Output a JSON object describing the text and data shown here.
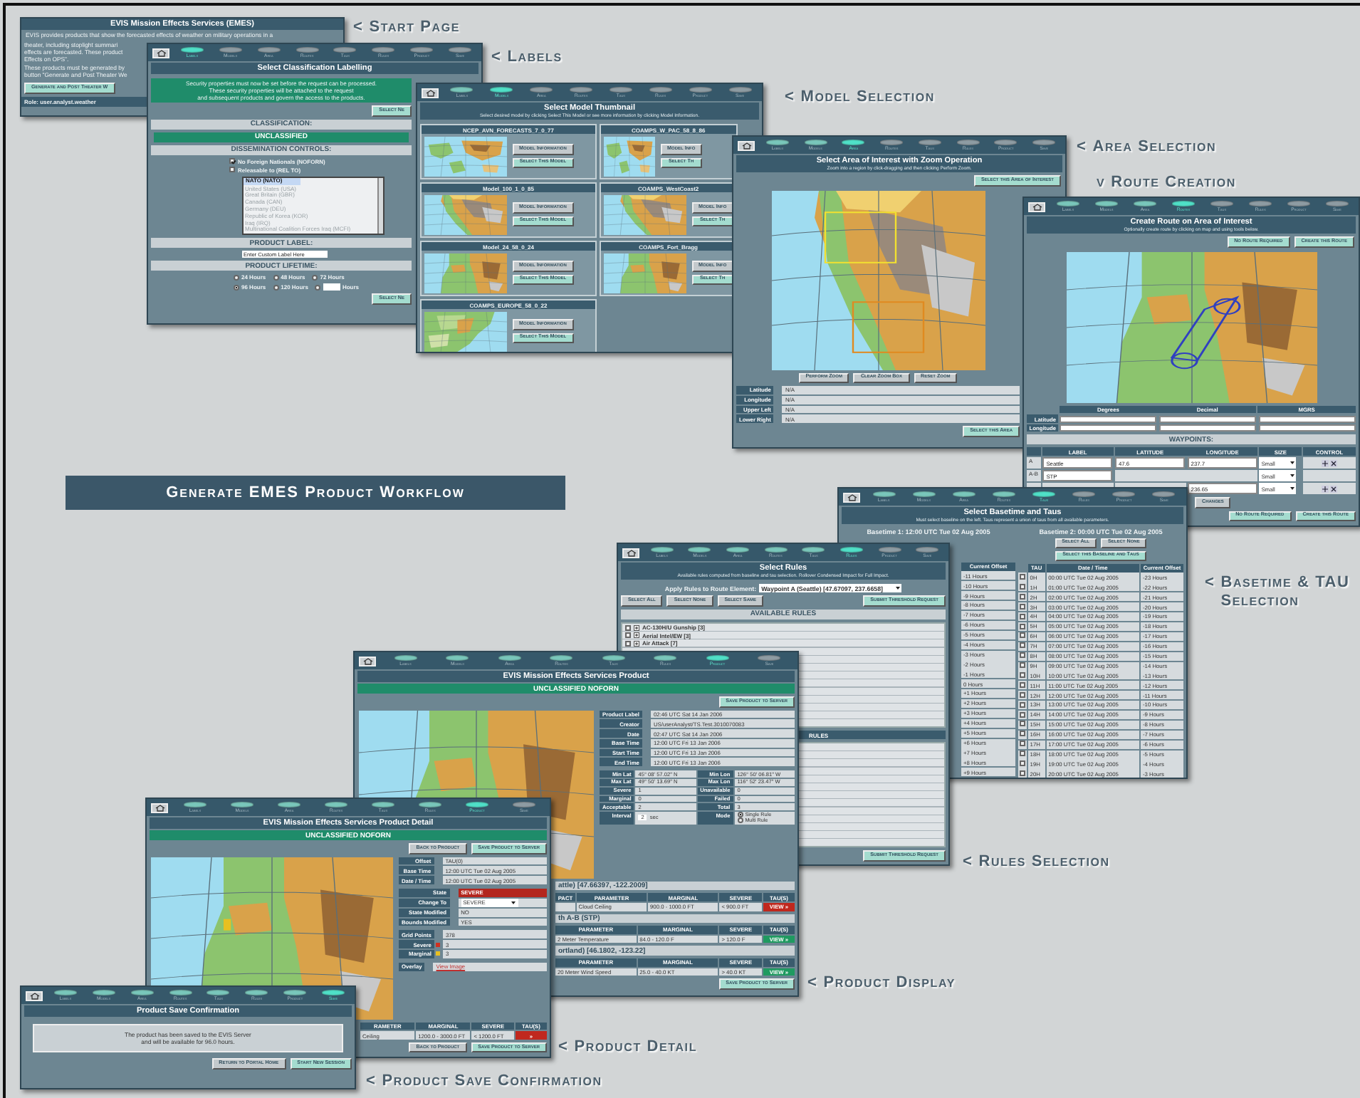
{
  "banner": {
    "title": "Generate EMES Product Workflow"
  },
  "captions": [
    {
      "arrow": "<",
      "lines": [
        "Start Page"
      ]
    },
    {
      "arrow": "<",
      "lines": [
        "Labels"
      ]
    },
    {
      "arrow": "<",
      "lines": [
        "Model Selection"
      ]
    },
    {
      "arrow": "<",
      "lines": [
        "Area Selection"
      ]
    },
    {
      "arrow": "v",
      "lines": [
        "Route Creation"
      ]
    },
    {
      "arrow": "<",
      "lines": [
        "Basetime & TAU",
        "Selection"
      ]
    },
    {
      "arrow": "<",
      "lines": [
        "Rules Selection"
      ]
    },
    {
      "arrow": "<",
      "lines": [
        "Product Display"
      ]
    },
    {
      "arrow": "<",
      "lines": [
        "Product Detail"
      ]
    },
    {
      "arrow": "<",
      "lines": [
        "Product Save Confirmation"
      ]
    }
  ],
  "windows": [
    {
      "title": "EVIS Mission Effects Services (EMES)",
      "lead": "EVIS provides products that show the forecasted effects of weather on military operations in a",
      "blocks": [
        {
          "kind": "text",
          "lines": [
            "theater, including stoplight summari",
            "effects are forecasted. These product",
            "Effects on OPS\"."
          ]
        },
        {
          "kind": "text",
          "lines": [
            "These products must be generated by",
            "button \"Generate and Post Theater We"
          ]
        },
        {
          "kind": "buttons",
          "items": [
            {
              "label": "Generate and Post Theater W",
              "kind": "action"
            }
          ]
        },
        {
          "kind": "footer",
          "text": "Role: user.analyst.weather"
        }
      ]
    },
    {
      "steps": [
        {
          "label": "Labels",
          "selected": true,
          "done": false
        },
        {
          "label": "Models",
          "selected": false,
          "done": false
        },
        {
          "label": "Area",
          "selected": false,
          "done": false
        },
        {
          "label": "Routes",
          "selected": false,
          "done": false
        },
        {
          "label": "Taus",
          "selected": false,
          "done": false
        },
        {
          "label": "Rules",
          "selected": false,
          "done": false
        },
        {
          "label": "Product",
          "selected": false,
          "done": false
        },
        {
          "label": "Save",
          "selected": false,
          "done": false
        }
      ],
      "title": "Select Classification Labelling",
      "blocks": [
        {
          "kind": "notice",
          "lines": [
            "Security properties must now be set before the request can be processed.",
            "These security properties will be attached to the request",
            "and subsequent products and govern the access to the products."
          ]
        },
        {
          "kind": "buttons",
          "items": [
            {
              "label": "Select Ne",
              "kind": "action"
            }
          ]
        },
        {
          "kind": "heading",
          "text": "CLASSIFICATION:"
        },
        {
          "kind": "banner",
          "text": "UNCLASSIFIED"
        },
        {
          "kind": "heading",
          "text": "DISSEMINATION CONTROLS:"
        },
        {
          "kind": "checks",
          "items": [
            {
              "label": "No Foreign Nationals (NOFORN)",
              "checked": true
            },
            {
              "label": "Releasable to (REL TO)",
              "checked": false
            }
          ]
        },
        {
          "kind": "listbox",
          "disabled": true,
          "items": [
            {
              "label": "NATO (NATO)",
              "selected": true
            },
            {
              "label": "United States (USA)",
              "selected": false
            },
            {
              "label": "Great Britain (GBR)",
              "selected": false
            },
            {
              "label": "Canada (CAN)",
              "selected": false
            },
            {
              "label": "Germany (DEU)",
              "selected": false
            },
            {
              "label": "Republic of Korea (KOR)",
              "selected": false
            },
            {
              "label": "Iraq (IRQ)",
              "selected": false
            },
            {
              "label": "Multinational Coalition Forces Iraq (MCFI)",
              "selected": false
            }
          ]
        },
        {
          "kind": "heading",
          "text": "PRODUCT LABEL:"
        },
        {
          "kind": "field",
          "value": "Enter Custom Label Here"
        },
        {
          "kind": "heading",
          "text": "PRODUCT LIFETIME:"
        },
        {
          "kind": "radios",
          "rows": [
            [
              {
                "label": "24 Hours",
                "selected": false
              },
              {
                "label": "48 Hours",
                "selected": false
              },
              {
                "label": "72 Hours",
                "selected": false
              }
            ],
            [
              {
                "label": "96 Hours",
                "selected": true
              },
              {
                "label": "120 Hours",
                "selected": false
              },
              {
                "label": "Hours",
                "selected": false,
                "input": true
              }
            ]
          ]
        },
        {
          "kind": "buttons",
          "items": [
            {
              "label": "Select Ne",
              "kind": "action"
            }
          ]
        }
      ]
    },
    {
      "steps": [
        {
          "label": "Labels",
          "selected": false,
          "done": true
        },
        {
          "label": "Models",
          "selected": true,
          "done": false
        },
        {
          "label": "Area",
          "selected": false,
          "done": false
        },
        {
          "label": "Routes",
          "selected": false,
          "done": false
        },
        {
          "label": "Taus",
          "selected": false,
          "done": false
        },
        {
          "label": "Rules",
          "selected": false,
          "done": false
        },
        {
          "label": "Product",
          "selected": false,
          "done": false
        },
        {
          "label": "Save",
          "selected": false,
          "done": false
        }
      ],
      "title": "Select Model Thumbnail",
      "subtitle": "Select desired model by clicking Select This Model or see more information by clicking Model Information.",
      "blocks": [
        {
          "kind": "models",
          "columns": [
            [
              {
                "name": "NCEP_AVN_FORECASTS_7_0_77",
                "buttons": [
                  "Model Information",
                  "Select This Model"
                ]
              },
              {
                "name": "Model_100_1_0_85",
                "buttons": [
                  "Model Information",
                  "Select This Model"
                ]
              },
              {
                "name": "Model_24_58_0_24",
                "buttons": [
                  "Model Information",
                  "Select This Model"
                ]
              },
              {
                "name": "COAMPS_EUROPE_58_0_22",
                "buttons": [
                  "Model Information",
                  "Select This Model"
                ]
              }
            ],
            [
              {
                "name": "COAMPS_W_PAC_58_8_86",
                "buttons": [
                  "Model Info",
                  "Select Th"
                ]
              },
              {
                "name": "COAMPS_WestCoast2",
                "buttons": [
                  "Model Info",
                  "Select Th"
                ]
              },
              {
                "name": "COAMPS_Fort_Bragg",
                "buttons": [
                  "Model Info",
                  "Select Th"
                ]
              }
            ]
          ]
        }
      ]
    },
    {
      "steps": [
        {
          "label": "Labels",
          "selected": false,
          "done": true
        },
        {
          "label": "Models",
          "selected": false,
          "done": true
        },
        {
          "label": "Area",
          "selected": true,
          "done": false
        },
        {
          "label": "Routes",
          "selected": false,
          "done": false
        },
        {
          "label": "Taus",
          "selected": false,
          "done": false
        },
        {
          "label": "Rules",
          "selected": false,
          "done": false
        },
        {
          "label": "Product",
          "selected": false,
          "done": false
        },
        {
          "label": "Save",
          "selected": false,
          "done": false
        }
      ],
      "title": "Select Area of Interest with Zoom Operation",
      "subtitle": "Zoom into a region by click-dragging and then clicking Perform Zoom.",
      "actions": [
        {
          "label": "Select this Area of Interest",
          "kind": "action"
        }
      ],
      "blocks": [
        {
          "kind": "picture"
        },
        {
          "kind": "buttons",
          "items": [
            {
              "label": "Perform Zoom",
              "kind": "plain"
            },
            {
              "label": "Clear Zoom Box",
              "kind": "plain"
            },
            {
              "label": "Reset Zoom",
              "kind": "plain"
            }
          ]
        },
        {
          "kind": "kv",
          "rows": [
            {
              "label": "Latitude",
              "value": "N/A",
              "kind": "text"
            },
            {
              "label": "Longitude",
              "value": "N/A",
              "kind": "text"
            },
            {
              "label": "Upper Left",
              "value": "N/A",
              "kind": "text"
            },
            {
              "label": "Lower Right",
              "value": "N/A",
              "kind": "text"
            }
          ]
        },
        {
          "kind": "buttons",
          "items": [
            {
              "label": "Select this Area",
              "kind": "action"
            }
          ]
        }
      ]
    },
    {
      "steps": [
        {
          "label": "Labels",
          "selected": false,
          "done": true
        },
        {
          "label": "Models",
          "selected": false,
          "done": true
        },
        {
          "label": "Area",
          "selected": false,
          "done": true
        },
        {
          "label": "Routes",
          "selected": true,
          "done": false
        },
        {
          "label": "Taus",
          "selected": false,
          "done": false
        },
        {
          "label": "Rules",
          "selected": false,
          "done": false
        },
        {
          "label": "Product",
          "selected": false,
          "done": false
        },
        {
          "label": "Save",
          "selected": false,
          "done": false
        }
      ],
      "title": "Create Route on Area of Interest",
      "subtitle": "Optionally create route by clicking on map and using tools below.",
      "actions": [
        {
          "label": "No Route Required",
          "kind": "action"
        },
        {
          "label": "Create this Route",
          "kind": "action"
        }
      ],
      "blocks": [
        {
          "kind": "picture"
        },
        {
          "kind": "coords",
          "columns": [
            "Degrees",
            "Decimal",
            "MGRS"
          ],
          "rows": [
            "Latitude",
            "Longitude"
          ]
        },
        {
          "kind": "heading",
          "text": "WAYPOINTS:"
        },
        {
          "kind": "waypoints",
          "columns": [
            "LABEL",
            "LATITUDE",
            "LONGITUDE",
            "SIZE",
            "CONTROL"
          ],
          "rows": [
            {
              "marker": "A",
              "label": "Seattle",
              "lat": "47.6",
              "lon": "237.7",
              "size": "Small",
              "controls": true
            },
            {
              "marker": "A-B",
              "label": "STP",
              "size": "Small",
              "controls": false
            },
            {
              "lon": "236.65",
              "size": "Small",
              "controls": true
            }
          ]
        },
        {
          "kind": "buttons",
          "items": [
            {
              "label": "Changes",
              "kind": "plain"
            }
          ]
        },
        {
          "kind": "buttons",
          "items": [
            {
              "label": "No Route Required",
              "kind": "action"
            },
            {
              "label": "Create this Route",
              "kind": "action"
            }
          ]
        }
      ]
    },
    {
      "steps": [
        {
          "label": "Labels",
          "selected": false,
          "done": true
        },
        {
          "label": "Models",
          "selected": false,
          "done": true
        },
        {
          "label": "Area",
          "selected": false,
          "done": true
        },
        {
          "label": "Routes",
          "selected": false,
          "done": true
        },
        {
          "label": "Taus",
          "selected": true,
          "done": false
        },
        {
          "label": "Rules",
          "selected": false,
          "done": false
        },
        {
          "label": "Product",
          "selected": false,
          "done": false
        },
        {
          "label": "Save",
          "selected": false,
          "done": false
        }
      ],
      "title": "Select Basetime and Taus",
      "subtitle": "Must select baseline on the left. Taus represent a union of taus from all available parameters.",
      "blocks": [
        {
          "kind": "basetimes",
          "left": {
            "heading": "Basetime 1: 12:00 UTC Tue 02 Aug 2005",
            "column": "Current Offset",
            "rows": [
              "-11 Hours",
              "-10 Hours",
              "-9 Hours",
              "-8 Hours",
              "-7 Hours",
              "-6 Hours",
              "-5 Hours",
              "-4 Hours",
              "-3 Hours",
              "-2 Hours",
              "-1 Hours",
              "0 Hours",
              "+1 Hours",
              "+2 Hours",
              "+3 Hours",
              "+4 Hours",
              "+5 Hours",
              "+6 Hours",
              "+7 Hours",
              "+8 Hours",
              "+9 Hours"
            ]
          },
          "right": {
            "heading": "Basetime 2: 00:00 UTC Tue 02 Aug 2005",
            "buttons": [
              {
                "label": "Select All",
                "kind": "plain"
              },
              {
                "label": "Select None",
                "kind": "plain"
              }
            ],
            "action": {
              "label": "Select this Baseline and Taus",
              "kind": "action"
            },
            "columns": [
              "TAU",
              "Date / Time",
              "Current Offset"
            ],
            "rows": [
              {
                "checked": false,
                "cells": [
                  "0H",
                  "00:00 UTC Tue 02 Aug 2005",
                  "-23 Hours"
                ]
              },
              {
                "checked": false,
                "cells": [
                  "1H",
                  "01:00 UTC Tue 02 Aug 2005",
                  "-22 Hours"
                ]
              },
              {
                "checked": false,
                "cells": [
                  "2H",
                  "02:00 UTC Tue 02 Aug 2005",
                  "-21 Hours"
                ]
              },
              {
                "checked": false,
                "cells": [
                  "3H",
                  "03:00 UTC Tue 02 Aug 2005",
                  "-20 Hours"
                ]
              },
              {
                "checked": false,
                "cells": [
                  "4H",
                  "04:00 UTC Tue 02 Aug 2005",
                  "-19 Hours"
                ]
              },
              {
                "checked": false,
                "cells": [
                  "5H",
                  "05:00 UTC Tue 02 Aug 2005",
                  "-18 Hours"
                ]
              },
              {
                "checked": false,
                "cells": [
                  "6H",
                  "06:00 UTC Tue 02 Aug 2005",
                  "-17 Hours"
                ]
              },
              {
                "checked": false,
                "cells": [
                  "7H",
                  "07:00 UTC Tue 02 Aug 2005",
                  "-16 Hours"
                ]
              },
              {
                "checked": false,
                "cells": [
                  "8H",
                  "08:00 UTC Tue 02 Aug 2005",
                  "-15 Hours"
                ]
              },
              {
                "checked": false,
                "cells": [
                  "9H",
                  "09:00 UTC Tue 02 Aug 2005",
                  "-14 Hours"
                ]
              },
              {
                "checked": false,
                "cells": [
                  "10H",
                  "10:00 UTC Tue 02 Aug 2005",
                  "-13 Hours"
                ]
              },
              {
                "checked": false,
                "cells": [
                  "11H",
                  "11:00 UTC Tue 02 Aug 2005",
                  "-12 Hours"
                ]
              },
              {
                "checked": false,
                "cells": [
                  "12H",
                  "12:00 UTC Tue 02 Aug 2005",
                  "-11 Hours"
                ]
              },
              {
                "checked": false,
                "cells": [
                  "13H",
                  "13:00 UTC Tue 02 Aug 2005",
                  "-10 Hours"
                ]
              },
              {
                "checked": false,
                "cells": [
                  "14H",
                  "14:00 UTC Tue 02 Aug 2005",
                  "-9 Hours"
                ]
              },
              {
                "checked": false,
                "cells": [
                  "15H",
                  "15:00 UTC Tue 02 Aug 2005",
                  "-8 Hours"
                ]
              },
              {
                "checked": false,
                "cells": [
                  "16H",
                  "16:00 UTC Tue 02 Aug 2005",
                  "-7 Hours"
                ]
              },
              {
                "checked": false,
                "cells": [
                  "17H",
                  "17:00 UTC Tue 02 Aug 2005",
                  "-6 Hours"
                ]
              },
              {
                "checked": false,
                "cells": [
                  "18H",
                  "18:00 UTC Tue 02 Aug 2005",
                  "-5 Hours"
                ]
              },
              {
                "checked": false,
                "cells": [
                  "19H",
                  "19:00 UTC Tue 02 Aug 2005",
                  "-4 Hours"
                ]
              },
              {
                "checked": false,
                "cells": [
                  "20H",
                  "20:00 UTC Tue 02 Aug 2005",
                  "-3 Hours"
                ]
              }
            ]
          }
        }
      ]
    },
    {
      "steps": [
        {
          "label": "Labels",
          "selected": false,
          "done": true
        },
        {
          "label": "Models",
          "selected": false,
          "done": true
        },
        {
          "label": "Area",
          "selected": false,
          "done": true
        },
        {
          "label": "Routes",
          "selected": false,
          "done": true
        },
        {
          "label": "Taus",
          "selected": false,
          "done": true
        },
        {
          "label": "Rules",
          "selected": true,
          "done": false
        },
        {
          "label": "Product",
          "selected": false,
          "done": false
        },
        {
          "label": "Save",
          "selected": false,
          "done": false
        }
      ],
      "title": "Select Rules",
      "subtitle": "Available rules computed from baseline and tau selection. Rollover Condensed Impact for Full Impact.",
      "blocks": [
        {
          "kind": "apply",
          "label": "Apply Rules to Route Element:",
          "value": "Waypoint A (Seattle) [47.67097, 237.6658]"
        },
        {
          "kind": "buttons",
          "items": [
            {
              "label": "Select All",
              "kind": "plain"
            },
            {
              "label": "Select None",
              "kind": "plain"
            },
            {
              "label": "Select Same",
              "kind": "plain"
            },
            {
              "label": "Submit Threshold Request",
              "kind": "action"
            }
          ]
        },
        {
          "kind": "heading",
          "text": "AVAILABLE RULES"
        },
        {
          "kind": "rules",
          "items": [
            {
              "label": "AC-130H/U Gunship [3]",
              "checked": false
            },
            {
              "label": "Aerial Intel/EW [3]",
              "checked": false
            },
            {
              "label": "Air Attack [7]",
              "checked": false
            }
          ]
        },
        {
          "kind": "tailheading",
          "text": "RULES"
        },
        {
          "kind": "rules"
        },
        {
          "kind": "buttons",
          "items": [
            {
              "label": "Submit Threshold Request",
              "kind": "action"
            }
          ]
        }
      ]
    },
    {
      "steps": [
        {
          "label": "Labels",
          "selected": false,
          "done": true
        },
        {
          "label": "Models",
          "selected": false,
          "done": true
        },
        {
          "label": "Area",
          "selected": false,
          "done": true
        },
        {
          "label": "Routes",
          "selected": false,
          "done": true
        },
        {
          "label": "Taus",
          "selected": false,
          "done": true
        },
        {
          "label": "Rules",
          "selected": false,
          "done": true
        },
        {
          "label": "Product",
          "selected": true,
          "done": false
        },
        {
          "label": "Save",
          "selected": false,
          "done": false
        }
      ],
      "title": "EVIS Mission Effects Services Product",
      "banner": "UNCLASSIFIED NOFORN",
      "blocks": [
        {
          "kind": "buttons",
          "items": [
            {
              "label": "Save Product to Server",
              "kind": "action"
            }
          ]
        },
        {
          "kind": "split",
          "left": [
            {
              "kind": "picture"
            }
          ],
          "right": [
            {
              "kind": "kv",
              "rows": [
                {
                  "label": "Product Label",
                  "value": "02:46 UTC Sat 14 Jan 2006",
                  "kind": "text"
                },
                {
                  "label": "Creator",
                  "value": "US/userAnalyst/TS.Test.3010070083",
                  "kind": "text"
                },
                {
                  "label": "Date",
                  "value": "02:47 UTC Sat 14 Jan 2006",
                  "kind": "text"
                },
                {
                  "label": "Base Time",
                  "value": "12:00 UTC Fri 13 Jan 2006",
                  "kind": "text"
                },
                {
                  "label": "Start Time",
                  "value": "12:00 UTC Fri 13 Jan 2006",
                  "kind": "text"
                },
                {
                  "label": "End Time",
                  "value": "12:00 UTC Fri 13 Jan 2006",
                  "kind": "text"
                }
              ]
            },
            {
              "kind": "kv2",
              "rows": [
                [
                  {
                    "label": "Min Lat",
                    "value": "45° 08' 57.02\" N",
                    "kind": "text"
                  },
                  {
                    "label": "Min Lon",
                    "value": "126° 50' 06.81\" W",
                    "kind": "text"
                  }
                ],
                [
                  {
                    "label": "Max Lat",
                    "value": "49° 50' 13.69\" N",
                    "kind": "text"
                  },
                  {
                    "label": "Max Lon",
                    "value": "116° 52' 23.47\" W",
                    "kind": "text"
                  }
                ],
                [
                  {
                    "label": "Severe",
                    "value": "1",
                    "kind": "text"
                  },
                  {
                    "label": "Unavailable",
                    "value": "0",
                    "kind": "text"
                  }
                ],
                [
                  {
                    "label": "Marginal",
                    "value": "0",
                    "kind": "text"
                  },
                  {
                    "label": "Failed",
                    "value": "0",
                    "kind": "text"
                  }
                ],
                [
                  {
                    "label": "Acceptable",
                    "value": "2",
                    "kind": "text"
                  },
                  {
                    "label": "Total",
                    "value": "3",
                    "kind": "text"
                  }
                ],
                [
                  {
                    "label": "Interval",
                    "value": "2",
                    "unit": "sec",
                    "kind": "interval"
                  },
                  {
                    "label": "Mode",
                    "kind": "radios",
                    "options": [
                      {
                        "label": "Single Rule",
                        "selected": true
                      },
                      {
                        "label": "Multi Rule",
                        "selected": false
                      }
                    ]
                  }
                ]
              ]
            }
          ]
        },
        {
          "kind": "impacts",
          "sections": [
            {
              "title": "attle) [47.66397, -122.2009]",
              "columns": [
                "PACT",
                "PARAMETER",
                "MARGINAL",
                "SEVERE",
                "TAU(S)"
              ],
              "rows": [
                {
                  "cells": [
                    "",
                    "Cloud Ceiling",
                    "900.0 - 1000.0 FT",
                    "< 900.0 FT"
                  ],
                  "view": "VIEW »",
                  "kind": "severe"
                }
              ]
            },
            {
              "title": "th A-B (STP)",
              "columns": [
                "PARAMETER",
                "MARGINAL",
                "SEVERE",
                "TAU(S)"
              ],
              "rows": [
                {
                  "cells": [
                    "2 Meter Temperature",
                    "84.0 - 120.0 F",
                    "> 120.0 F"
                  ],
                  "view": "VIEW »",
                  "kind": "acceptable"
                }
              ]
            },
            {
              "title": "ortland) [46.1802, -123.22]",
              "columns": [
                "PARAMETER",
                "MARGINAL",
                "SEVERE",
                "TAU(S)"
              ],
              "rows": [
                {
                  "cells": [
                    "20 Meter Wind Speed",
                    "25.0 - 40.0 KT",
                    "> 40.0 KT"
                  ],
                  "view": "VIEW »",
                  "kind": "acceptable"
                }
              ]
            }
          ]
        },
        {
          "kind": "buttons",
          "items": [
            {
              "label": "Save Product to Server",
              "kind": "action"
            }
          ]
        }
      ]
    },
    {
      "steps": [
        {
          "label": "Labels",
          "selected": false,
          "done": true
        },
        {
          "label": "Models",
          "selected": false,
          "done": true
        },
        {
          "label": "Area",
          "selected": false,
          "done": true
        },
        {
          "label": "Routes",
          "selected": false,
          "done": true
        },
        {
          "label": "Taus",
          "selected": false,
          "done": true
        },
        {
          "label": "Rules",
          "selected": false,
          "done": true
        },
        {
          "label": "Product",
          "selected": true,
          "done": false
        },
        {
          "label": "Save",
          "selected": false,
          "done": false
        }
      ],
      "title": "EVIS Mission Effects Services Product Detail",
      "banner": "UNCLASSIFIED NOFORN",
      "blocks": [
        {
          "kind": "buttons",
          "items": [
            {
              "label": "Back to Product",
              "kind": "plain"
            },
            {
              "label": "Save Product to Server",
              "kind": "action"
            }
          ]
        },
        {
          "kind": "split",
          "left": [
            {
              "kind": "picture"
            }
          ],
          "right": [
            {
              "kind": "kv",
              "rows": [
                {
                  "label": "Offset",
                  "value": "TAU(0)",
                  "kind": "text"
                },
                {
                  "label": "Base Time",
                  "value": "12:00 UTC Tue 02 Aug 2005",
                  "kind": "text"
                },
                {
                  "label": "Date / Time",
                  "value": "12:00 UTC Tue 02 Aug 2005",
                  "kind": "text"
                }
              ]
            },
            {
              "kind": "kv",
              "rows": [
                {
                  "label": "State",
                  "value": "SEVERE",
                  "kind": "alert"
                },
                {
                  "label": "Change To",
                  "value": "SEVERE",
                  "kind": "select"
                },
                {
                  "label": "State Modified",
                  "value": "NO",
                  "kind": "text"
                },
                {
                  "label": "Bounds Modified",
                  "value": "YES",
                  "kind": "text"
                }
              ]
            },
            {
              "kind": "kv",
              "rows": [
                {
                  "label": "Grid Points",
                  "value": "378",
                  "kind": "text"
                },
                {
                  "label": "Severe",
                  "value": "3",
                  "kind": "text",
                  "color": "#d03020"
                },
                {
                  "label": "Marginal",
                  "value": "3",
                  "kind": "text",
                  "color": "#e8c020"
                }
              ]
            },
            {
              "kind": "kv",
              "rows": [
                {
                  "label": "Overlay",
                  "value": "View Image",
                  "kind": "link"
                }
              ]
            }
          ]
        },
        {
          "kind": "impacts",
          "sections": [
            {
              "columns": [
                "RAMETER",
                "MARGINAL",
                "SEVERE",
                "TAU(S)"
              ],
              "rows": [
                {
                  "cells": [
                    "Ceiling",
                    "1200.0 - 3000.0 FT",
                    "< 1200.0 FT"
                  ],
                  "view": "»",
                  "kind": "severe"
                }
              ]
            }
          ]
        },
        {
          "kind": "buttons",
          "items": [
            {
              "label": "Back to Product",
              "kind": "plain"
            },
            {
              "label": "Save Product to Server",
              "kind": "action"
            }
          ]
        }
      ]
    },
    {
      "steps": [
        {
          "label": "Labels",
          "selected": false,
          "done": true
        },
        {
          "label": "Models",
          "selected": false,
          "done": true
        },
        {
          "label": "Area",
          "selected": false,
          "done": true
        },
        {
          "label": "Routes",
          "selected": false,
          "done": true
        },
        {
          "label": "Taus",
          "selected": false,
          "done": true
        },
        {
          "label": "Rules",
          "selected": false,
          "done": true
        },
        {
          "label": "Product",
          "selected": false,
          "done": true
        },
        {
          "label": "Save",
          "selected": true,
          "done": false
        }
      ],
      "title": "Product Save Confirmation",
      "blocks": [
        {
          "kind": "message",
          "lines": [
            "The product has been saved to the EVIS Server",
            "and will be available for 96.0 hours."
          ]
        },
        {
          "kind": "buttons",
          "items": [
            {
              "label": "Return to Portal Home",
              "kind": "plain"
            },
            {
              "label": "Start New Session",
              "kind": "action"
            }
          ]
        }
      ]
    }
  ]
}
